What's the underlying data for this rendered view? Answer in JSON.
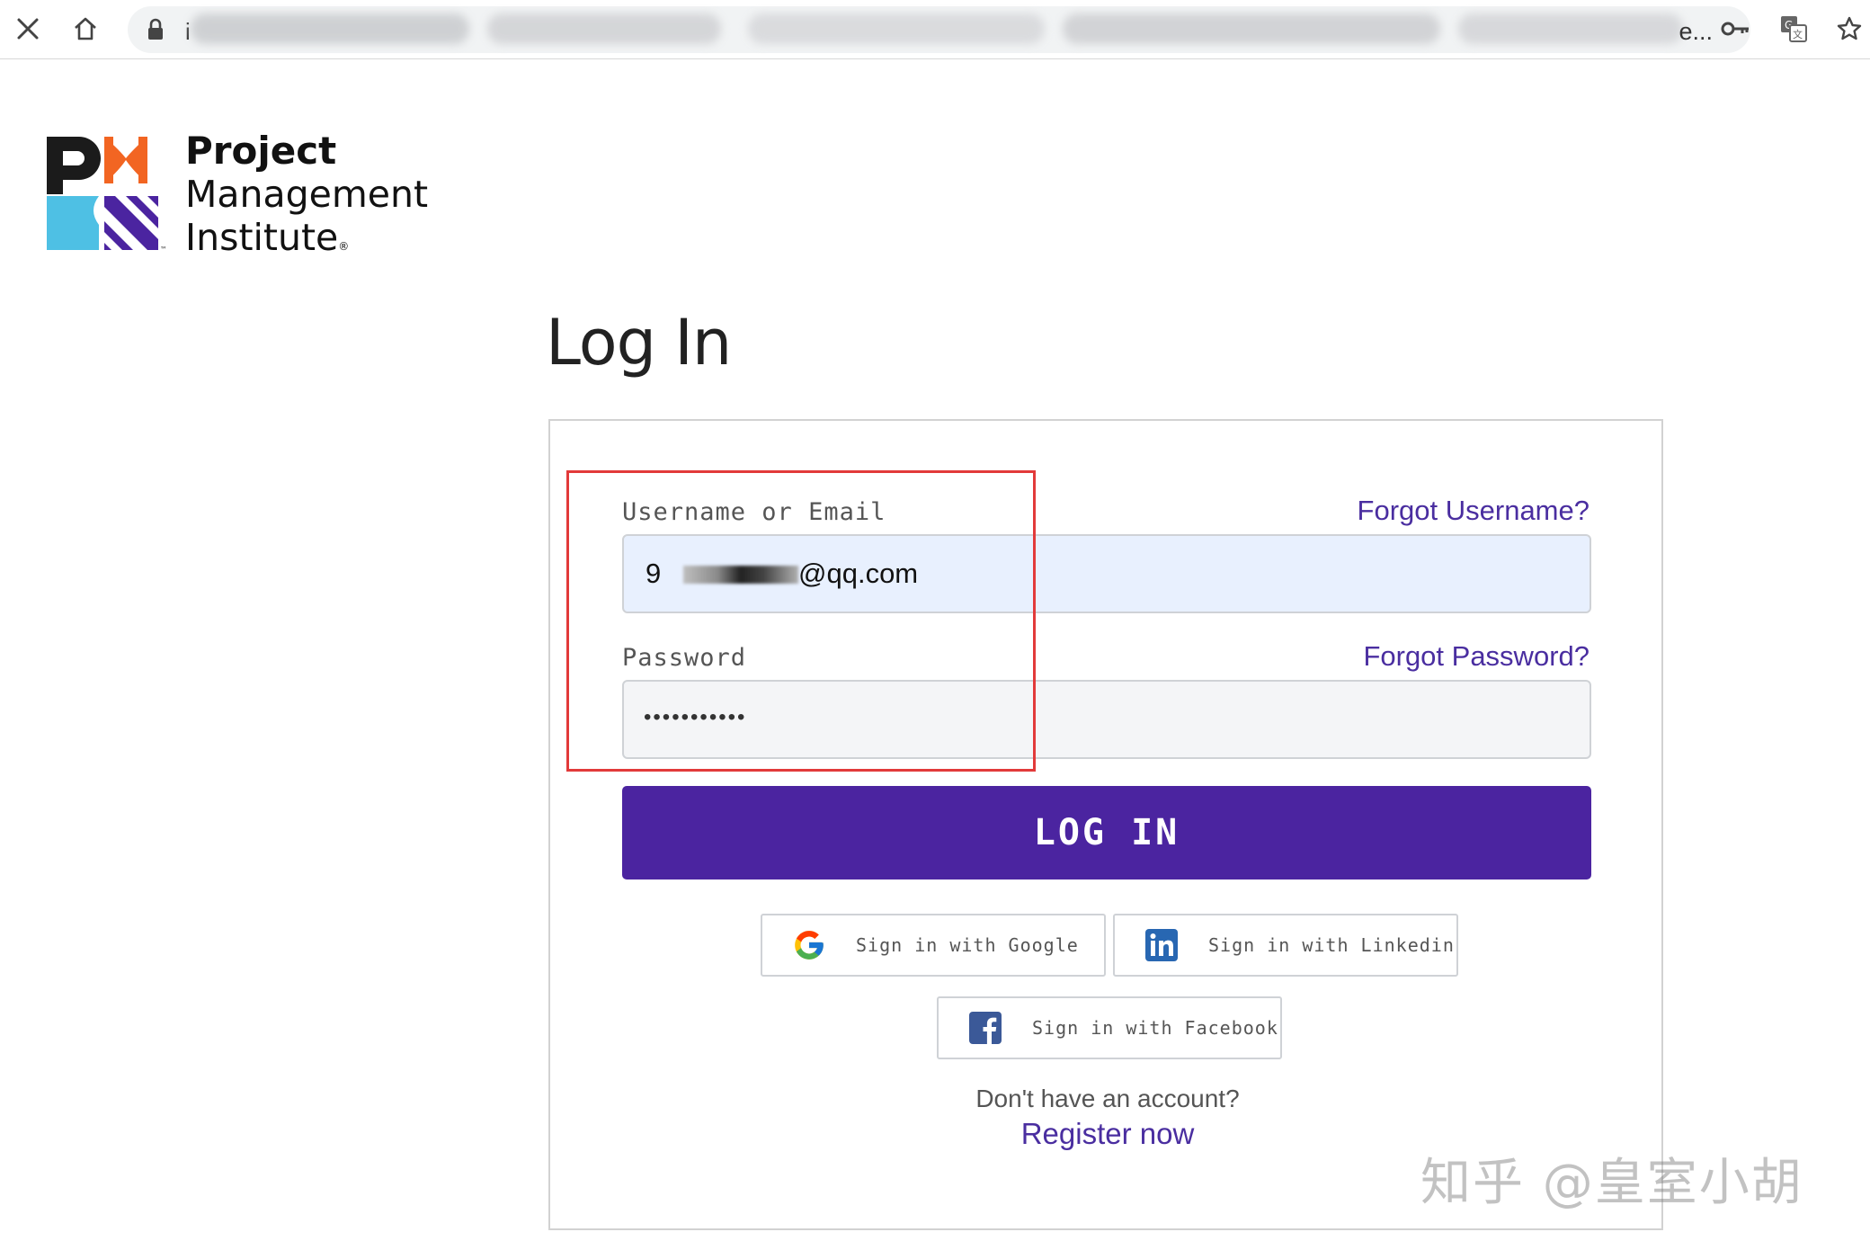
{
  "browser": {
    "url_visible_prefix": "i",
    "url_visible_suffix": "e...",
    "icons": [
      "close-icon",
      "home-icon",
      "lock-icon",
      "key-icon",
      "translate-icon",
      "star-icon"
    ]
  },
  "logo": {
    "line1": "Project",
    "line2": "Management",
    "line3": "Institute",
    "registered": "®",
    "trademark": "™",
    "colors": {
      "black": "#1b1b1b",
      "orange": "#f26522",
      "blue": "#4ec0e4",
      "purple": "#4b24a0"
    }
  },
  "page": {
    "title": "Log In"
  },
  "form": {
    "username_label": "Username or Email",
    "forgot_username": "Forgot Username?",
    "email_prefix": "9",
    "email_suffix": "@qq.com",
    "password_label": "Password",
    "forgot_password": "Forgot Password?",
    "password_value": "•••••••••••",
    "login_button": "LOG IN"
  },
  "social": {
    "google": "Sign in with Google",
    "linkedin": "Sign in with Linkedin",
    "facebook": "Sign in with Facebook"
  },
  "footer": {
    "no_account": "Don't have an account?",
    "register": "Register now"
  },
  "watermark": "知乎 @皇室小胡",
  "colors": {
    "accent": "#4b24a0",
    "link": "#4a2ea0",
    "annotation": "#e23a3a",
    "email_input_bg": "#e8f0fe"
  }
}
